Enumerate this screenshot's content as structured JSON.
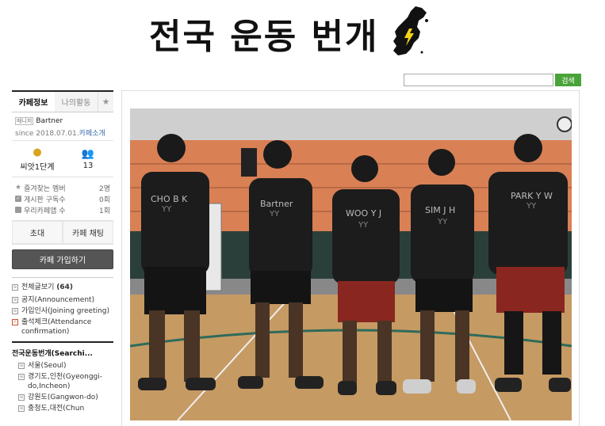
{
  "header": {
    "title": "전국 운동 번개",
    "brand_color": "#111111",
    "accent_lightning": "#f5d316"
  },
  "search": {
    "input_value": "",
    "button_label": "검색",
    "button_color": "#4aa33a"
  },
  "sidebar": {
    "tabs": [
      "카페정보",
      "나의활동"
    ],
    "manager_badge": "매니저",
    "manager_name": "Bartner",
    "since": "since 2018.07.01.",
    "intro_link": "카페소개",
    "level": "씨앗1단계",
    "members": "13",
    "info_rows": [
      {
        "label": "즐겨찾는 멤버",
        "value": "2명"
      },
      {
        "label": "게시판 구독수",
        "value": "0회"
      },
      {
        "label": "우리카페앱 수",
        "value": "1회"
      }
    ],
    "buttons": [
      "초대",
      "카페 채팅"
    ],
    "join_label": "카페 가입하기",
    "all_posts": "전체글보기",
    "all_posts_count": "(64)",
    "menu_items": [
      "공지(Announcement)",
      "가입인사(Joining greeting)",
      "출석체크(Attendance confirmation)"
    ],
    "category_title": "전국운동번개(Searchi...",
    "regions": [
      "서울(Seoul)",
      "경기도,인천(Gyeonggi-do,Incheon)",
      "강원도(Gangwon-do)",
      "충청도,대전(Chun"
    ]
  },
  "photo": {
    "jerseys": [
      "CHO B K",
      "Bartner",
      "WOO Y J",
      "SIM J H",
      "PARK Y W"
    ]
  }
}
